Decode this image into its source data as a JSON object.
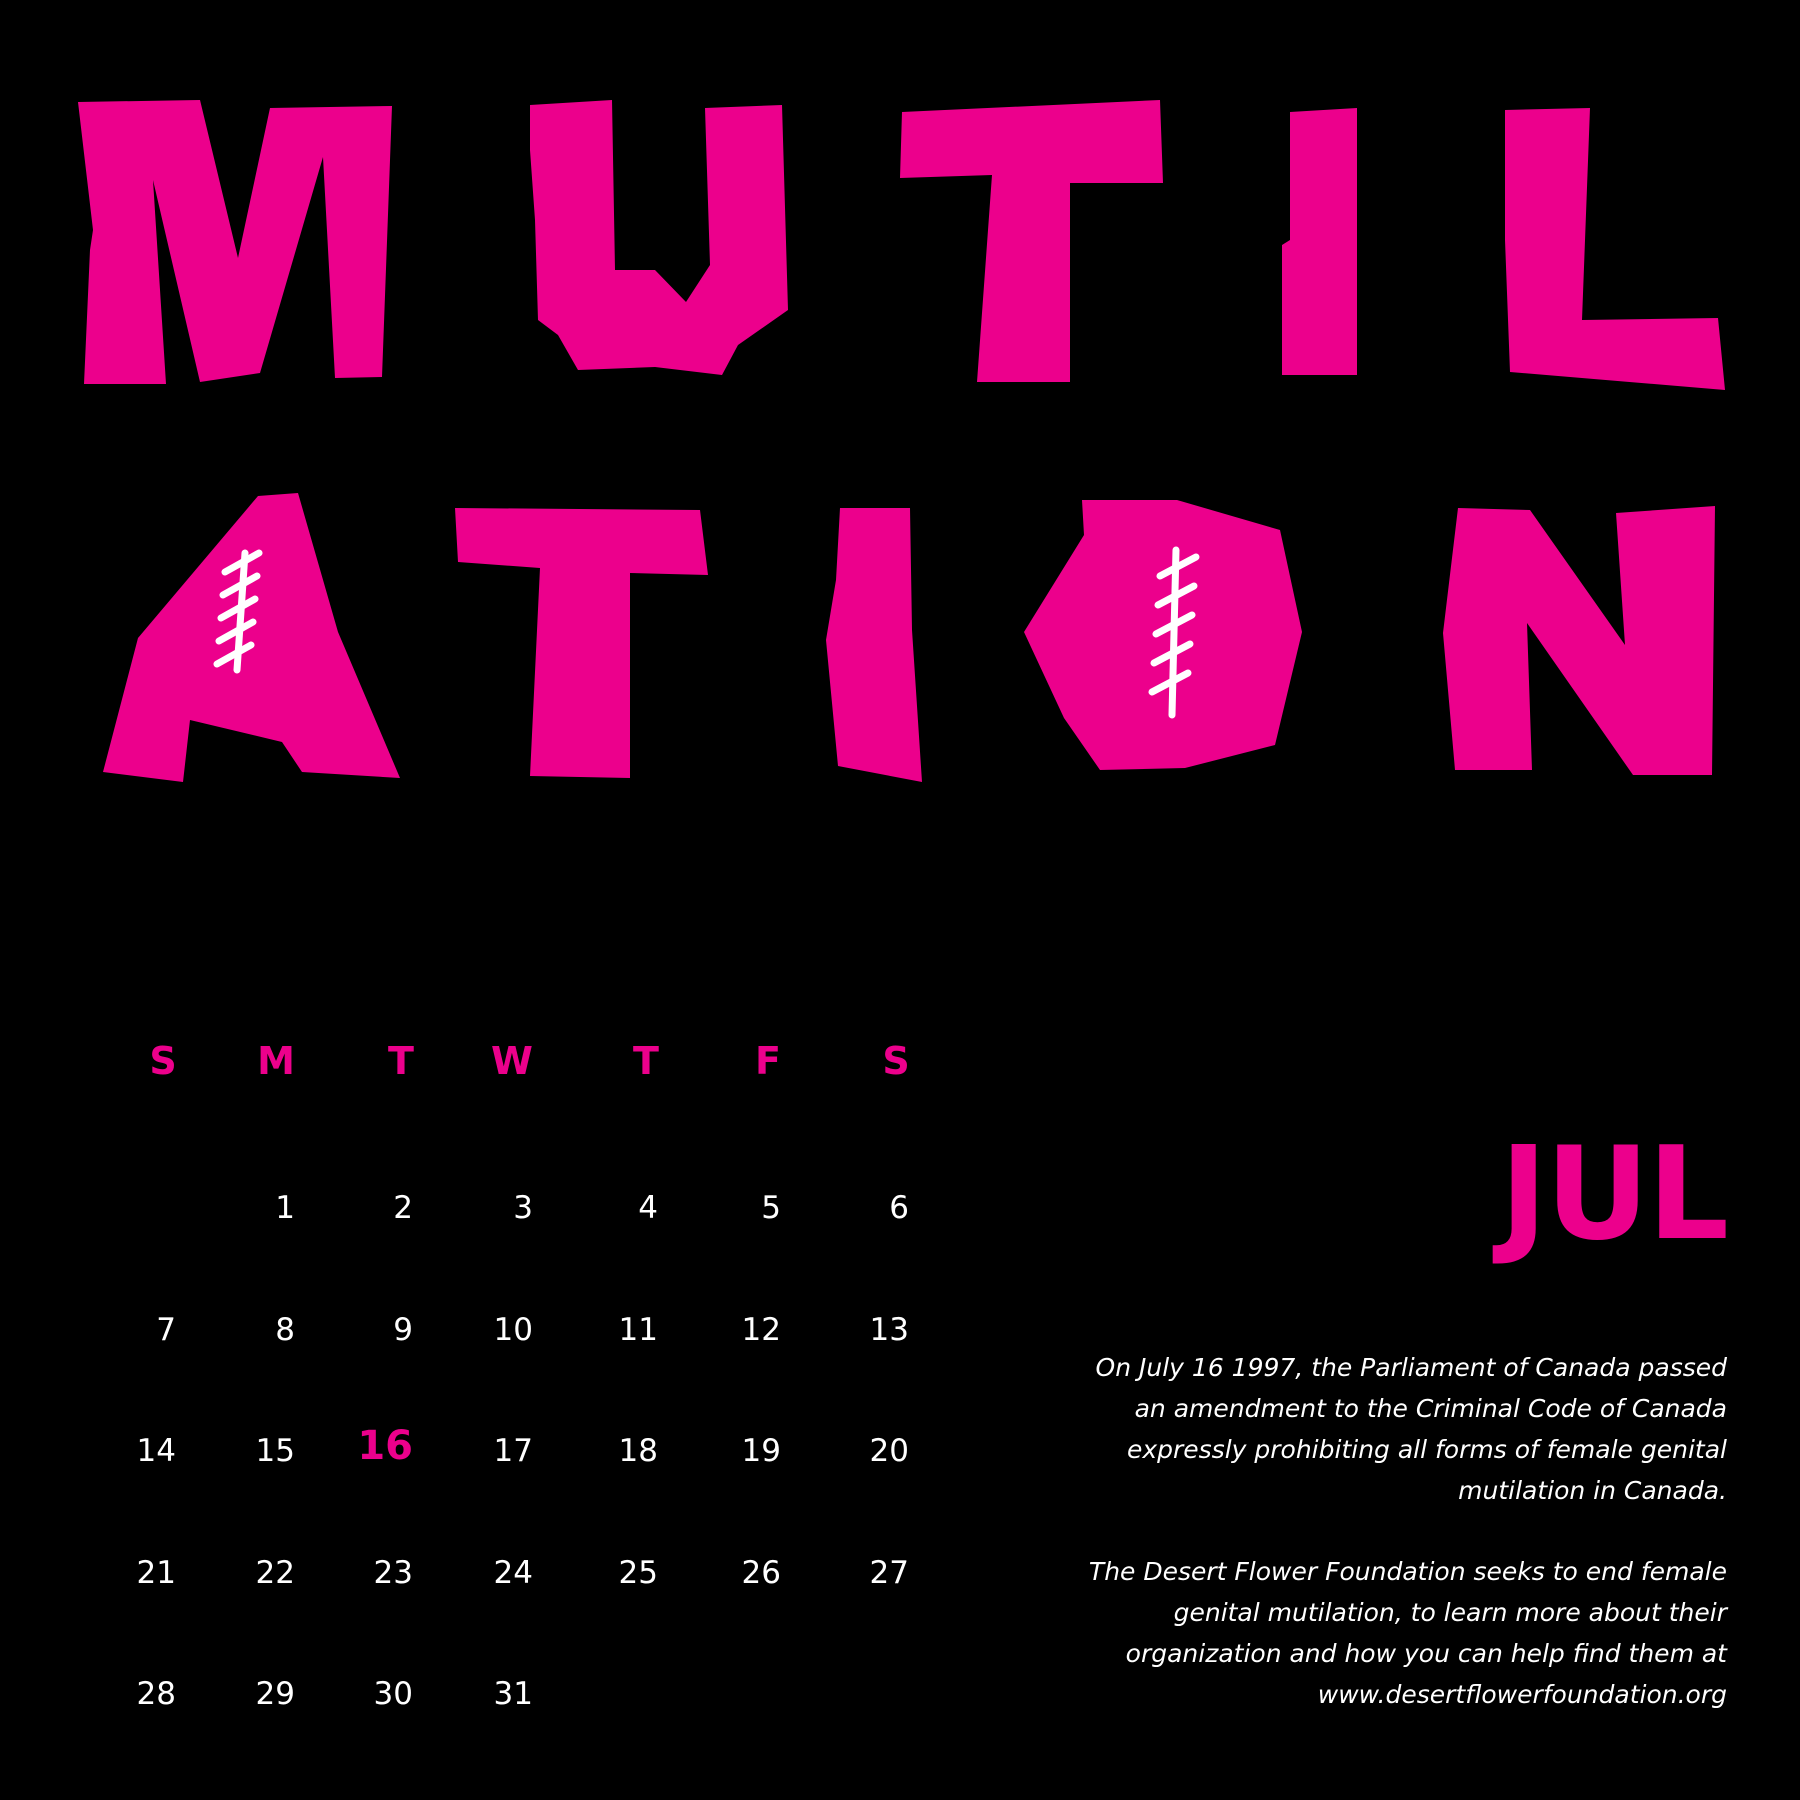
{
  "poster": {
    "title_top": "MUTIL",
    "title_bottom": "ATION",
    "accent_color": "#ec008c",
    "background_color": "#000000",
    "mark_color": "#ffffff",
    "scar_icon": "stitched-scar-icon"
  },
  "calendar": {
    "weekdays": [
      "S",
      "M",
      "T",
      "W",
      "T",
      "F",
      "S"
    ],
    "weeks": [
      [
        "",
        "1",
        "2",
        "3",
        "4",
        "5",
        "6"
      ],
      [
        "7",
        "8",
        "9",
        "10",
        "11",
        "12",
        "13"
      ],
      [
        "14",
        "15",
        "16",
        "17",
        "18",
        "19",
        "20"
      ],
      [
        "21",
        "22",
        "23",
        "24",
        "25",
        "26",
        "27"
      ],
      [
        "28",
        "29",
        "30",
        "31",
        "",
        "",
        ""
      ]
    ],
    "highlighted_day": "16"
  },
  "month": {
    "label": "JUL"
  },
  "notes": {
    "history": "On July 16 1997, the Parliament of Canada passed an amendment to the Criminal Code of Canada expressly prohibiting all forms of female genital mutilation in Canada.",
    "foundation": "The Desert Flower Foundation seeks to end female genital mutilation, to learn more about their organization and how you can help find them at www.desertflowerfoundation.org"
  }
}
